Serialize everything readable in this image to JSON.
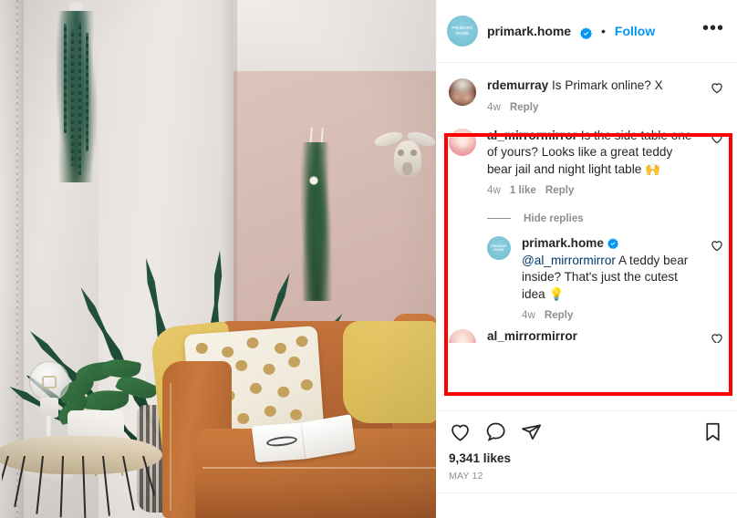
{
  "post": {
    "header": {
      "avatar_label_line1": "PRIMARK",
      "avatar_label_line2": "HOME",
      "username": "primark.home",
      "verified_icon": "verified-badge-icon",
      "separator": "•",
      "follow_label": "Follow",
      "more_options_label": "•••"
    },
    "photo": {
      "alt": "living room with tan leather sofa, polka dot cushion, yellow throw, side table with lamp and plant, hanging plants and bull skull wall decor"
    },
    "comments": [
      {
        "id": "comment-1",
        "avatar": "rdemurray-avatar",
        "username": "rdemurray",
        "text": "Is Primark online? X",
        "time": "4w",
        "likes": "",
        "reply_label": "Reply",
        "like_icon": "heart-outline-icon"
      },
      {
        "id": "comment-2",
        "avatar": "al-mirrormirror-avatar",
        "username": "al_mirrormirror",
        "text": "Is the side table one of yours? Looks like a great teddy bear jail and night light table 🙌",
        "time": "4w",
        "likes": "1 like",
        "reply_label": "Reply",
        "like_icon": "heart-outline-icon",
        "hide_replies_label": "Hide replies",
        "replies": [
          {
            "id": "reply-1",
            "avatar": "primark-home-avatar",
            "avatar_label_line1": "PRIMARK",
            "avatar_label_line2": "HOME",
            "username": "primark.home",
            "verified_icon": "verified-badge-icon",
            "mention": "@al_mirrormirror",
            "text": " A teddy bear inside? That's just the cutest idea 💡",
            "time": "4w",
            "reply_label": "Reply",
            "like_icon": "heart-outline-icon"
          }
        ]
      },
      {
        "id": "comment-3-cut-off",
        "avatar": "al-mirrormirror-avatar",
        "username": "al_mirrormirror",
        "text": "",
        "time": "",
        "likes": "",
        "reply_label": "",
        "like_icon": "heart-outline-icon"
      }
    ],
    "actions": {
      "like_icon": "heart-outline-icon",
      "comment_icon": "speech-bubble-icon",
      "share_icon": "paper-plane-icon",
      "save_icon": "bookmark-outline-icon",
      "likes_count": "9,341 likes",
      "date": "MAY 12"
    }
  },
  "annotation": {
    "highlight_color": "#ff0000",
    "highlight_target": "al_mirrormirror comment thread"
  },
  "colors": {
    "link_blue": "#0095f6",
    "mention_blue": "#00376b",
    "text_primary": "#262626",
    "text_muted": "#8e8e8e",
    "brand_avatar": "#79c3d6"
  }
}
